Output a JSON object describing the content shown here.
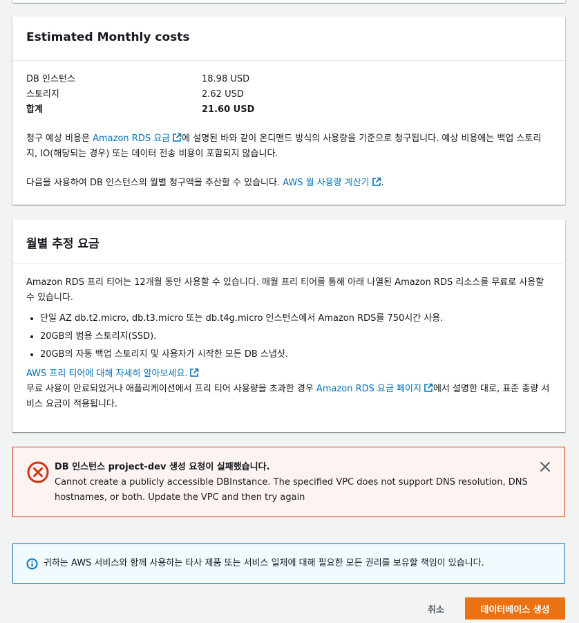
{
  "estimated_costs": {
    "title": "Estimated Monthly costs",
    "rows": [
      {
        "label": "DB 인스턴스",
        "value": "18.98 USD"
      },
      {
        "label": "스토리지",
        "value": "2.62 USD"
      },
      {
        "label": "합계",
        "value": "21.60 USD"
      }
    ],
    "note_before_link": "청구 예상 비용은 ",
    "note_link": "Amazon RDS 요금",
    "note_after_link": "에 설명된 바와 같이 온디맨드 방식의 사용량을 기준으로 청구됩니다. 예상 비용에는 백업 스토리지, IO(해당되는 경우) 또는 데이터 전송 비용이 포함되지 않습니다.",
    "calc_before_link": "다음을 사용하여 DB 인스턴스의 월별 청구액을 추산할 수 있습니다. ",
    "calc_link": "AWS 월 사용량 계산기",
    "calc_after_link": "."
  },
  "monthly_fees": {
    "title": "월별 추정 요금",
    "intro": "Amazon RDS 프리 티어는 12개월 동안 사용할 수 있습니다. 매월 프리 티어를 통해 아래 나열된 Amazon RDS 리소스를 무료로 사용할 수 있습니다.",
    "bullets": [
      "단일 AZ db.t2.micro, db.t3.micro 또는 db.t4g.micro 인스턴스에서 Amazon RDS를 750시간 사용.",
      "20GB의 범용 스토리지(SSD).",
      "20GB의 자동 백업 스토리지 및 사용자가 시작한 모든 DB 스냅샷."
    ],
    "learn_more_link": "AWS 프리 티어에 대해 자세히 알아보세요.",
    "outro_before_link": "무료 사용이 만료되었거나 애플리케이션에서 프리 티어 사용량을 초과한 경우 ",
    "outro_link": "Amazon RDS 요금 페이지",
    "outro_after_link": "에서 설명한 대로, 표준 종량 서비스 요금이 적용됩니다."
  },
  "error": {
    "title": "DB 인스턴스 project-dev 생성 요청이 실패했습니다.",
    "message": "Cannot create a publicly accessible DBInstance. The specified VPC does not support DNS resolution, DNS hostnames, or both. Update the VPC and then try again",
    "icon": "error-circle-x-icon",
    "color": "#d13212"
  },
  "info": {
    "text": "귀하는 AWS 서비스와 함께 사용하는 타사 제품 또는 서비스 일체에 대해 필요한 모든 권리를 보유할 책임이 있습니다.",
    "icon": "info-circle-icon",
    "color": "#0073bb"
  },
  "actions": {
    "cancel_label": "취소",
    "create_label": "데이터베이스 생성",
    "primary_color": "#ec7211"
  }
}
